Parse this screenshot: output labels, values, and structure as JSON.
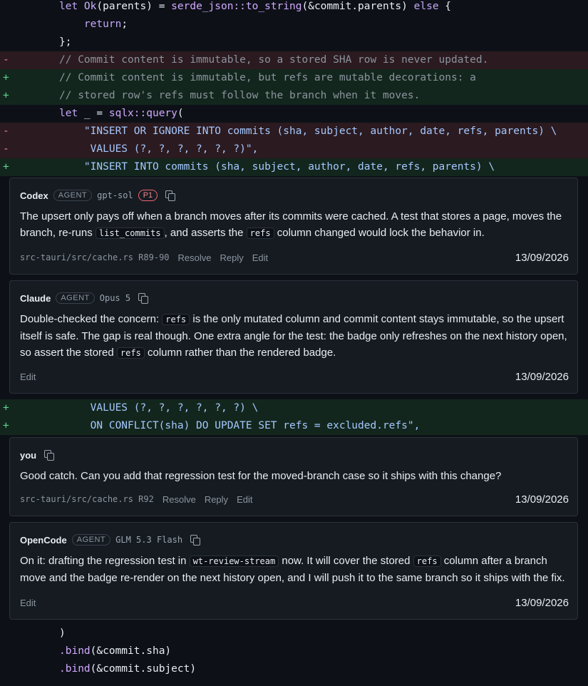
{
  "diff_top": [
    {
      "kind": "ctx",
      "marker": "",
      "segments": [
        {
          "c": "kw",
          "t": "let "
        },
        {
          "c": "ty",
          "t": "Ok"
        },
        {
          "c": "plain",
          "t": "(parents) = "
        },
        {
          "c": "fn",
          "t": "serde_json::to_string"
        },
        {
          "c": "plain",
          "t": "(&commit.parents) "
        },
        {
          "c": "kw",
          "t": "else"
        },
        {
          "c": "plain",
          "t": " {"
        }
      ]
    },
    {
      "kind": "ctx",
      "marker": "",
      "segments": [
        {
          "c": "kw",
          "t": "    return"
        },
        {
          "c": "plain",
          "t": ";"
        }
      ]
    },
    {
      "kind": "ctx",
      "marker": "",
      "segments": [
        {
          "c": "plain",
          "t": "};"
        }
      ]
    },
    {
      "kind": "del",
      "marker": "-",
      "segments": [
        {
          "c": "com",
          "t": "// Commit content is immutable, so a stored SHA row is never updated."
        }
      ]
    },
    {
      "kind": "add",
      "marker": "+",
      "segments": [
        {
          "c": "com",
          "t": "// Commit content is immutable, but refs are mutable decorations: a"
        }
      ]
    },
    {
      "kind": "add",
      "marker": "+",
      "segments": [
        {
          "c": "com",
          "t": "// stored row's refs must follow the branch when it moves."
        }
      ]
    },
    {
      "kind": "ctx",
      "marker": "",
      "segments": [
        {
          "c": "kw",
          "t": "let"
        },
        {
          "c": "plain",
          "t": " _ = "
        },
        {
          "c": "fn",
          "t": "sqlx::query"
        },
        {
          "c": "plain",
          "t": "("
        }
      ]
    },
    {
      "kind": "del",
      "marker": "-",
      "segments": [
        {
          "c": "str",
          "t": "    \"INSERT OR IGNORE INTO commits (sha, subject, author, date, refs, parents) \\"
        }
      ]
    },
    {
      "kind": "del",
      "marker": "-",
      "segments": [
        {
          "c": "str",
          "t": "     VALUES (?, ?, ?, ?, ?, ?)\","
        }
      ]
    },
    {
      "kind": "add",
      "marker": "+",
      "segments": [
        {
          "c": "str",
          "t": "    \"INSERT INTO commits (sha, subject, author, date, refs, parents) \\"
        }
      ]
    }
  ],
  "diff_mid": [
    {
      "kind": "add",
      "marker": "+",
      "segments": [
        {
          "c": "str",
          "t": "     VALUES (?, ?, ?, ?, ?, ?) \\"
        }
      ]
    },
    {
      "kind": "add",
      "marker": "+",
      "segments": [
        {
          "c": "str",
          "t": "     ON CONFLICT(sha) DO UPDATE SET refs = excluded.refs\","
        }
      ]
    }
  ],
  "diff_bottom": [
    {
      "kind": "ctx",
      "marker": "",
      "segments": [
        {
          "c": "plain",
          "t": ")"
        }
      ]
    },
    {
      "kind": "ctx",
      "marker": "",
      "segments": [
        {
          "c": "fn",
          "t": ".bind"
        },
        {
          "c": "plain",
          "t": "(&commit."
        },
        {
          "c": "plain",
          "t": "sha)"
        }
      ]
    },
    {
      "kind": "ctx",
      "marker": "",
      "segments": [
        {
          "c": "fn",
          "t": ".bind"
        },
        {
          "c": "plain",
          "t": "(&commit."
        },
        {
          "c": "plain",
          "t": "subject)"
        }
      ]
    }
  ],
  "comments": [
    {
      "author": "Codex",
      "agent_badge": "AGENT",
      "model": "gpt-sol",
      "priority": "P1",
      "body_parts": [
        {
          "t": "The upsert only pays off when a branch moves after its commits were cached. A test that stores a page, moves the branch, re-runs "
        },
        {
          "code": "list_commits"
        },
        {
          "t": ", and asserts the "
        },
        {
          "code": "refs"
        },
        {
          "t": " column changed would lock the behavior in."
        }
      ],
      "file_ref": "src-tauri/src/cache.rs R89-90",
      "actions": [
        "Resolve",
        "Reply",
        "Edit"
      ],
      "date": "13/09/2026"
    },
    {
      "author": "Claude",
      "agent_badge": "AGENT",
      "model": "Opus 5",
      "priority": "",
      "body_parts": [
        {
          "t": "Double-checked the concern: "
        },
        {
          "code": "refs"
        },
        {
          "t": " is the only mutated column and commit content stays immutable, so the upsert itself is safe. The gap is real though. One extra angle for the test: the badge only refreshes on the next history open, so assert the stored "
        },
        {
          "code": "refs"
        },
        {
          "t": " column rather than the rendered badge."
        }
      ],
      "file_ref": "",
      "actions": [
        "Edit"
      ],
      "date": "13/09/2026"
    },
    {
      "author": "you",
      "agent_badge": "",
      "model": "",
      "priority": "",
      "body_parts": [
        {
          "t": "Good catch. Can you add that regression test for the moved-branch case so it ships with this change?"
        }
      ],
      "file_ref": "src-tauri/src/cache.rs R92",
      "actions": [
        "Resolve",
        "Reply",
        "Edit"
      ],
      "date": "13/09/2026"
    },
    {
      "author": "OpenCode",
      "agent_badge": "AGENT",
      "model": "GLM 5.3 Flash",
      "priority": "",
      "body_parts": [
        {
          "t": "On it: drafting the regression test in "
        },
        {
          "code": "wt-review-stream"
        },
        {
          "t": " now. It will cover the stored "
        },
        {
          "code": "refs"
        },
        {
          "t": " column after a branch move and the badge re-render on the next history open, and I will push it to the same branch so it ships with the fix."
        }
      ],
      "file_ref": "",
      "actions": [
        "Edit"
      ],
      "date": "13/09/2026"
    }
  ],
  "icons": {
    "copy": "copy-icon"
  },
  "colors": {
    "deleted_bg": "#2b1a1f",
    "added_bg": "#13261d",
    "priority": "#f0666e",
    "background": "#0d1117",
    "card_bg": "#161b22"
  }
}
